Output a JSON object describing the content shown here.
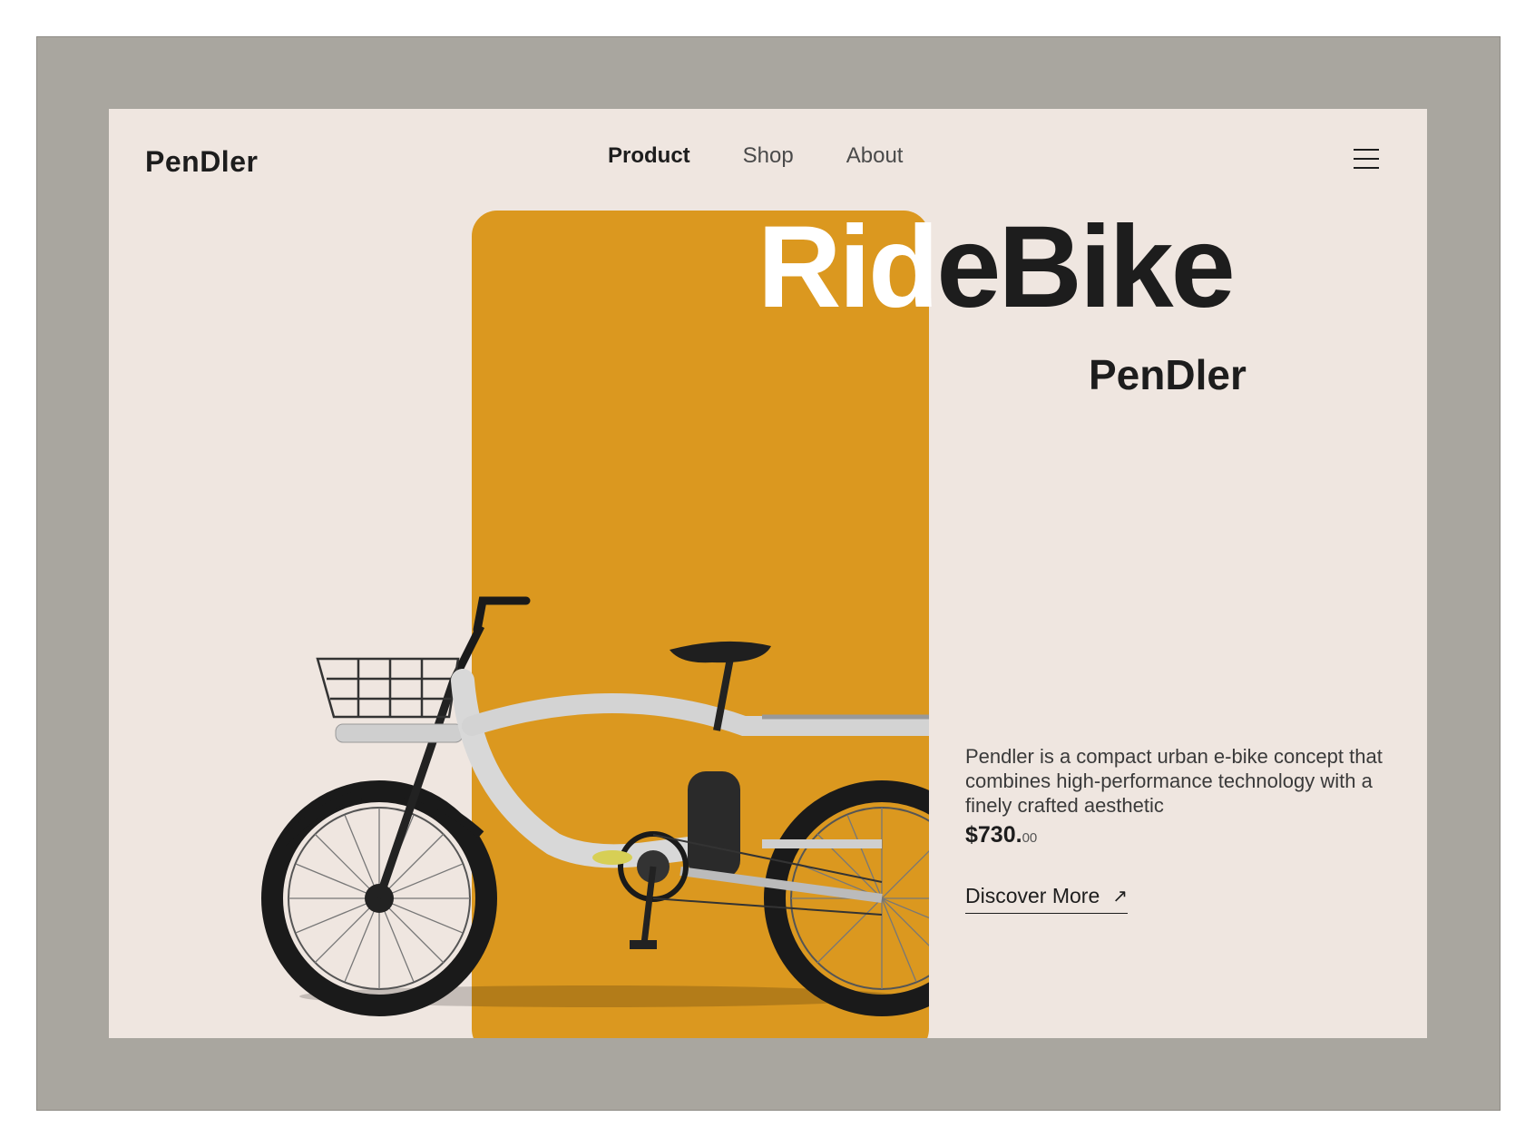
{
  "brand": "PenDler",
  "nav": {
    "items": [
      "Product",
      "Shop",
      "About"
    ],
    "active": "Product"
  },
  "hero": {
    "headline_light": "Rid",
    "headline_dark": "eBike",
    "subheadline": "PenDler"
  },
  "product": {
    "description": "Pendler is a compact urban e-bike concept that combines high-performance technology with a finely crafted aesthetic",
    "price_main": "$730.",
    "price_cents": "00",
    "cta_label": "Discover More",
    "cta_icon": "arrow-up-right-icon"
  },
  "colors": {
    "frame": "#a9a69f",
    "page": "#efe6e0",
    "accent": "#db981f",
    "text": "#1d1d1d"
  }
}
